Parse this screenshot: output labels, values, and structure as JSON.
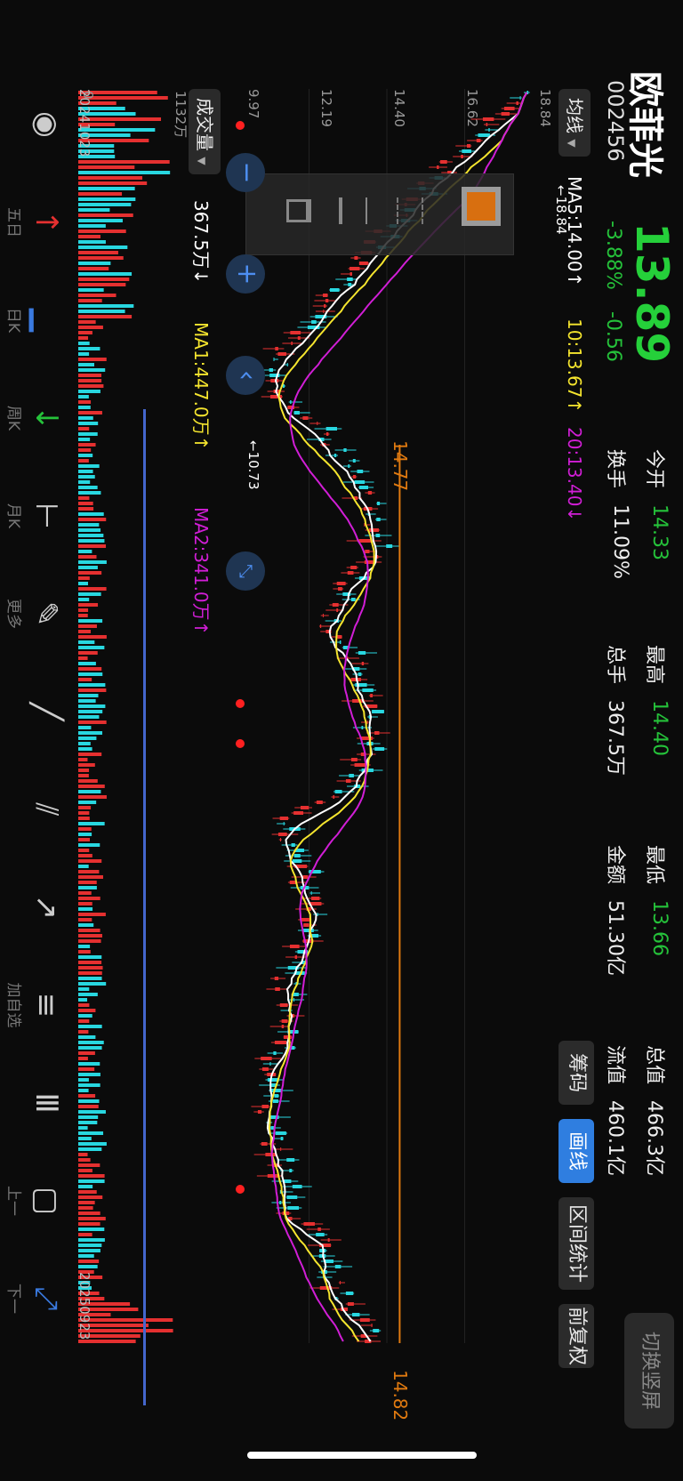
{
  "stock": {
    "name": "欧菲光",
    "code": "002456",
    "price": "13.89",
    "change_pct": "-3.88%",
    "change": "-0.56",
    "stats": [
      {
        "label": "今开",
        "value": "14.33"
      },
      {
        "label": "最高",
        "value": "14.40"
      },
      {
        "label": "最低",
        "value": "13.66"
      },
      {
        "label": "总值",
        "value": "466.3亿"
      },
      {
        "label": "换手",
        "value": "11.09%"
      },
      {
        "label": "总手",
        "value": "367.5万"
      },
      {
        "label": "金额",
        "value": "51.30亿"
      },
      {
        "label": "流值",
        "value": "460.1亿"
      }
    ],
    "switch_label": "切换竖屏"
  },
  "buttons": {
    "chips": "筹码",
    "draw": "画线",
    "range_stats": "区间统计",
    "fq": "前复权"
  },
  "ma_bar": {
    "selector": "均线",
    "ma5": "MA5:14.00↑",
    "ma10": "10:13.67↑",
    "ma20": "20:13.40↓"
  },
  "vol_bar": {
    "selector": "成交量",
    "vol": "367.5万↓",
    "ma1": "MA1:447.0万↑",
    "ma2": "MA2:341.0万↑"
  },
  "price_axis": [
    "18.84",
    "16.62",
    "14.40",
    "12.19",
    "9.97"
  ],
  "vol_axis": [
    "1132万",
    "0"
  ],
  "dates": {
    "start": "20241023",
    "end": "20250923"
  },
  "annotations": {
    "high": "←18.84",
    "low": "←10.73",
    "line1": "14.77",
    "line2": "14.82"
  },
  "toolbar": [
    {
      "label": "",
      "icon": "eye-icon"
    },
    {
      "label": "五日",
      "icon": "arrow-up-icon"
    },
    {
      "label": "日K",
      "icon": "bar-icon"
    },
    {
      "label": "周K",
      "icon": "arrow-down-icon"
    },
    {
      "label": "月K",
      "icon": "segment-icon"
    },
    {
      "label": "更多",
      "icon": "pencil-icon"
    },
    {
      "label": "",
      "icon": "line-icon"
    },
    {
      "label": "",
      "icon": "parallel-icon"
    },
    {
      "label": "",
      "icon": "ray-icon"
    },
    {
      "label": "加自选",
      "icon": "golden-icon"
    },
    {
      "label": "",
      "icon": "stripes-icon"
    },
    {
      "label": "上一",
      "icon": "rect-icon"
    },
    {
      "label": "下一",
      "icon": "expand-icon"
    }
  ],
  "colors": {
    "up": "#e53030",
    "down": "#28d7e0",
    "ma5": "#ffffff",
    "ma10": "#f5e52e",
    "ma20": "#d11ed6",
    "accent": "#2f7ee0",
    "hline": "#e07a10"
  }
}
